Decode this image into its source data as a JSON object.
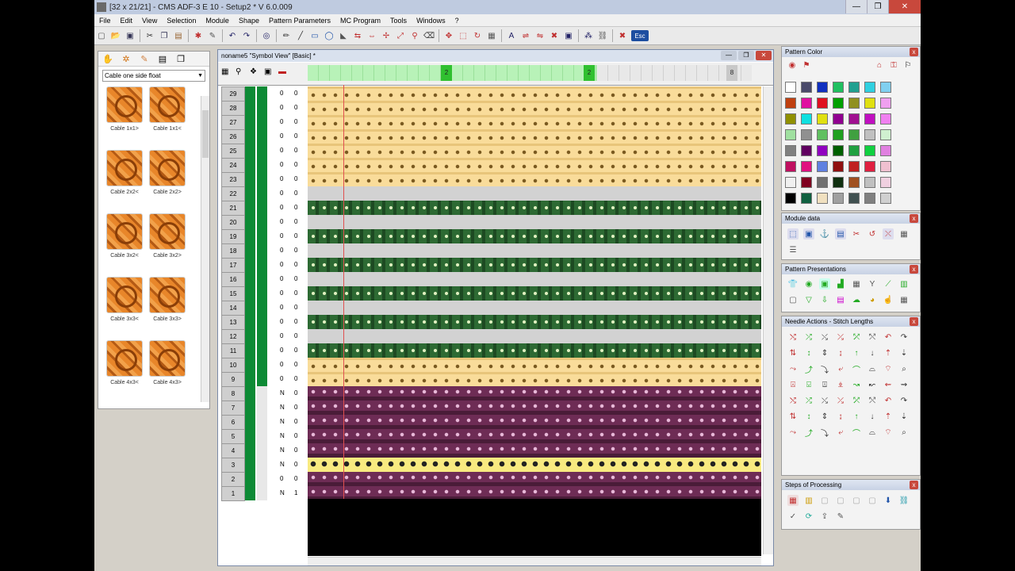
{
  "window": {
    "title": "[32 x 21/21] - CMS ADF-3 E 10 - Setup2 *    V 6.0.009",
    "minimize": "—",
    "maximize": "❐",
    "close": "✕"
  },
  "menu": [
    "File",
    "Edit",
    "View",
    "Selection",
    "Module",
    "Shape",
    "Pattern Parameters",
    "MC Program",
    "Tools",
    "Windows",
    "?"
  ],
  "toolbar": {
    "esc_label": "Esc"
  },
  "left_panel": {
    "dropdown_value": "Cable one side float",
    "items": [
      {
        "label": "Cable 1x1>"
      },
      {
        "label": "Cable 1x1<"
      },
      {
        "label": "Cable 2x2<"
      },
      {
        "label": "Cable 2x2>"
      },
      {
        "label": "Cable 3x2<"
      },
      {
        "label": "Cable 3x2>"
      },
      {
        "label": "Cable 3x3<"
      },
      {
        "label": "Cable 3x3>"
      },
      {
        "label": "Cable 4x3<"
      },
      {
        "label": "Cable 4x3>"
      }
    ]
  },
  "document": {
    "title": "noname5 \"Symbol View\" [Basic] *",
    "ruler_markers": [
      "2",
      "2",
      "8"
    ],
    "rows": [
      {
        "num": "29",
        "v1": "0",
        "v2": "0",
        "type": "cream"
      },
      {
        "num": "28",
        "v1": "0",
        "v2": "0",
        "type": "cream"
      },
      {
        "num": "27",
        "v1": "0",
        "v2": "0",
        "type": "cream"
      },
      {
        "num": "26",
        "v1": "0",
        "v2": "0",
        "type": "cream"
      },
      {
        "num": "25",
        "v1": "0",
        "v2": "0",
        "type": "cream"
      },
      {
        "num": "24",
        "v1": "0",
        "v2": "0",
        "type": "cream"
      },
      {
        "num": "23",
        "v1": "0",
        "v2": "0",
        "type": "cream"
      },
      {
        "num": "22",
        "v1": "0",
        "v2": "0",
        "type": "gray"
      },
      {
        "num": "21",
        "v1": "0",
        "v2": "0",
        "type": "green"
      },
      {
        "num": "20",
        "v1": "0",
        "v2": "0",
        "type": "gray"
      },
      {
        "num": "19",
        "v1": "0",
        "v2": "0",
        "type": "green"
      },
      {
        "num": "18",
        "v1": "0",
        "v2": "0",
        "type": "gray"
      },
      {
        "num": "17",
        "v1": "0",
        "v2": "0",
        "type": "green"
      },
      {
        "num": "16",
        "v1": "0",
        "v2": "0",
        "type": "gray"
      },
      {
        "num": "15",
        "v1": "0",
        "v2": "0",
        "type": "green"
      },
      {
        "num": "14",
        "v1": "0",
        "v2": "0",
        "type": "gray"
      },
      {
        "num": "13",
        "v1": "0",
        "v2": "0",
        "type": "green"
      },
      {
        "num": "12",
        "v1": "0",
        "v2": "0",
        "type": "gray"
      },
      {
        "num": "11",
        "v1": "0",
        "v2": "0",
        "type": "green"
      },
      {
        "num": "10",
        "v1": "0",
        "v2": "0",
        "type": "cream"
      },
      {
        "num": "9",
        "v1": "0",
        "v2": "0",
        "type": "cream"
      },
      {
        "num": "8",
        "v1": "N",
        "v2": "0",
        "type": "purple"
      },
      {
        "num": "7",
        "v1": "N",
        "v2": "0",
        "type": "purple"
      },
      {
        "num": "6",
        "v1": "N",
        "v2": "0",
        "type": "purple"
      },
      {
        "num": "5",
        "v1": "N",
        "v2": "0",
        "type": "purple"
      },
      {
        "num": "4",
        "v1": "N",
        "v2": "0",
        "type": "purple"
      },
      {
        "num": "3",
        "v1": "N",
        "v2": "0",
        "type": "yellow"
      },
      {
        "num": "2",
        "v1": "0",
        "v2": "0",
        "type": "purple"
      },
      {
        "num": "1",
        "v1": "N",
        "v2": "1",
        "type": "purple"
      }
    ]
  },
  "panels": {
    "pattern_color": "Pattern Color",
    "module_data": "Module data",
    "pattern_presentations": "Pattern Presentations",
    "needle_actions": "Needle Actions - Stitch Lengths",
    "steps_processing": "Steps of Processing",
    "close_glyph": "x"
  },
  "palette": [
    [
      "#ffffff",
      "#4a4a6a",
      "#1030c0",
      "#20c060",
      "#20a090",
      "#30d0e0",
      "#80d0f0"
    ],
    [
      "#c04010",
      "#e010a0",
      "#e01020",
      "#00a000",
      "#909020",
      "#e0e010",
      "#f0a0f0"
    ],
    [
      "#909000",
      "#10e0e0",
      "#e0e010",
      "#900090",
      "#a01090",
      "#c010c0",
      "#f080f0"
    ],
    [
      "#a0e0a0",
      "#909090",
      "#60c060",
      "#20a020",
      "#40a040",
      "#c0c0c0",
      "#d0f0d0"
    ],
    [
      "#808080",
      "#600060",
      "#9000c0",
      "#006000",
      "#20a040",
      "#10d040",
      "#e080e0"
    ],
    [
      "#c01060",
      "#e01080",
      "#6080e0",
      "#901010",
      "#c02020",
      "#e02040",
      "#f0c0d0"
    ],
    [
      "#f0f0f0",
      "#800020",
      "#707070",
      "#103010",
      "#a05020",
      "#c0c0c0",
      "#f0d0e0"
    ],
    [
      "#000000",
      "#106040",
      "#f0e0c0",
      "#a0a0a0",
      "#405050",
      "#808080",
      "#d0d0d0"
    ]
  ],
  "colors": {
    "cream": "#f9dc9a",
    "cream_dark": "#e8c57a",
    "gray": "#d2d2d2",
    "green": "#2d6a33",
    "green_dark": "#1d4a22",
    "purple": "#6e2c55",
    "purple_dark": "#4a1c38",
    "yellow": "#f8ea80",
    "header_green": "#0d8a35"
  }
}
